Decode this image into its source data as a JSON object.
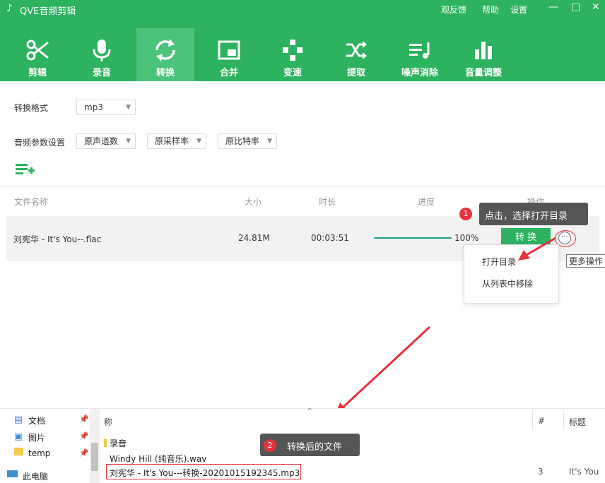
{
  "app": {
    "title": "QVE音频剪辑"
  },
  "title_menu": {
    "feedback": "观反馈",
    "help": "帮助",
    "settings": "设置"
  },
  "window_controls": {
    "minimize": "—",
    "maximize": "□",
    "close": "✕"
  },
  "tabs": [
    {
      "label": "剪辑",
      "icon": "scissors-icon"
    },
    {
      "label": "录音",
      "icon": "microphone-icon"
    },
    {
      "label": "转换",
      "icon": "convert-icon",
      "active": true
    },
    {
      "label": "合并",
      "icon": "merge-icon"
    },
    {
      "label": "变速",
      "icon": "speed-icon"
    },
    {
      "label": "提取",
      "icon": "extract-icon"
    },
    {
      "label": "噪声消除",
      "icon": "noise-icon"
    },
    {
      "label": "音量调整",
      "icon": "volume-icon"
    }
  ],
  "settings": {
    "format_label": "转换格式",
    "format_value": "mp3",
    "params_label": "音频参数设置",
    "channels": "原声道数",
    "sample_rate": "原采样率",
    "bitrate": "原比特率"
  },
  "table": {
    "headers": {
      "name": "文件名称",
      "size": "大小",
      "duration": "时长",
      "progress": "进度",
      "action": "操作"
    },
    "row": {
      "name": "刘宪华 - It's You--.flac",
      "size": "24.81M",
      "duration": "00:03:51",
      "progress_value": 100,
      "progress_text": "100%",
      "convert_button": "转 换",
      "more_glyph": "···"
    }
  },
  "annotations": {
    "step1_number": "1",
    "step1_text": "点击，选择打开目录",
    "step2_number": "2",
    "step2_text": "转换后的文件"
  },
  "context_menu": {
    "open_dir": "打开目录",
    "remove": "从列表中移除"
  },
  "tooltip": "更多操作",
  "explorer": {
    "nav": [
      {
        "label": "文档",
        "icon": "document-icon"
      },
      {
        "label": "图片",
        "icon": "picture-icon"
      },
      {
        "label": "temp",
        "icon": "folder-icon"
      },
      {
        "label": "此电脑",
        "icon": "computer-icon"
      }
    ],
    "headers": {
      "name": "称",
      "number": "#",
      "title": "标题"
    },
    "files": [
      {
        "name": "录音",
        "number": "",
        "title": ""
      },
      {
        "name": "Windy Hill (纯音乐).wav",
        "number": "",
        "title": ""
      },
      {
        "name": "刘宪华 - It's You---转换-20201015192345.mp3",
        "number": "3",
        "title": "It's You"
      }
    ]
  },
  "colors": {
    "brand": "#2db25f",
    "button": "#2db25f",
    "annotation": "#e8313b"
  }
}
